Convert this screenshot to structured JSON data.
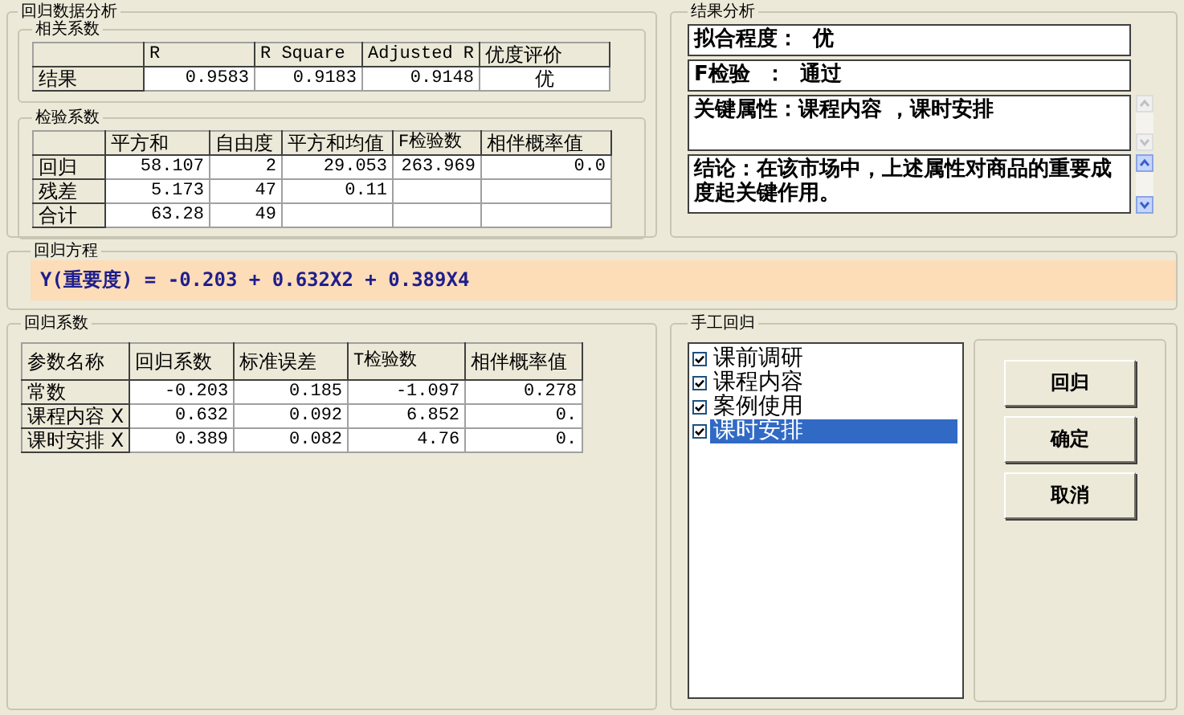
{
  "title": "回归数据分析",
  "correlation": {
    "title": "相关系数",
    "columns": [
      null,
      "R",
      "R Square",
      "Adjusted R",
      "优度评价"
    ],
    "rows": [
      [
        "结果",
        "0.9583",
        "0.9183",
        "0.9148",
        "优"
      ]
    ]
  },
  "test": {
    "title": "检验系数",
    "columns": [
      null,
      "平方和",
      "自由度",
      "平方和均值",
      "F检验数",
      "相伴概率值"
    ],
    "rows": [
      [
        "回归",
        "58.107",
        "2",
        "29.053",
        "263.969",
        "0.0"
      ],
      [
        "残差",
        "5.173",
        "47",
        "0.11",
        null,
        null
      ],
      [
        "合计",
        "63.28",
        "49",
        null,
        null,
        null
      ]
    ]
  },
  "result_analysis": {
    "title": "结果分析",
    "lines": [
      "拟合程度：  优",
      "F检验  ：  通过",
      "关键属性：课程内容 ，课时安排",
      "结论：在该市场中，上述属性对商品的重要成度起关键作用。"
    ]
  },
  "equation": {
    "title": "回归方程",
    "text": "Y(重要度) = -0.203 + 0.632X2 + 0.389X4"
  },
  "coefficients": {
    "title": "回归系数",
    "columns": [
      "参数名称",
      "回归系数",
      "标准误差",
      "T检验数",
      "相伴概率值"
    ],
    "rows": [
      [
        "常数",
        "-0.203",
        "0.185",
        "-1.097",
        "0.278"
      ],
      [
        "课程内容 X",
        "0.632",
        "0.092",
        "6.852",
        "0."
      ],
      [
        "课时安排 X",
        "0.389",
        "0.082",
        "4.76",
        "0."
      ]
    ]
  },
  "manual": {
    "title": "手工回归",
    "items": [
      {
        "label": "课前调研",
        "checked": true,
        "selected": false
      },
      {
        "label": "课程内容",
        "checked": true,
        "selected": false
      },
      {
        "label": "案例使用",
        "checked": true,
        "selected": false
      },
      {
        "label": "课时安排",
        "checked": true,
        "selected": true
      }
    ],
    "buttons": [
      "回归",
      "确定",
      "取消"
    ]
  }
}
